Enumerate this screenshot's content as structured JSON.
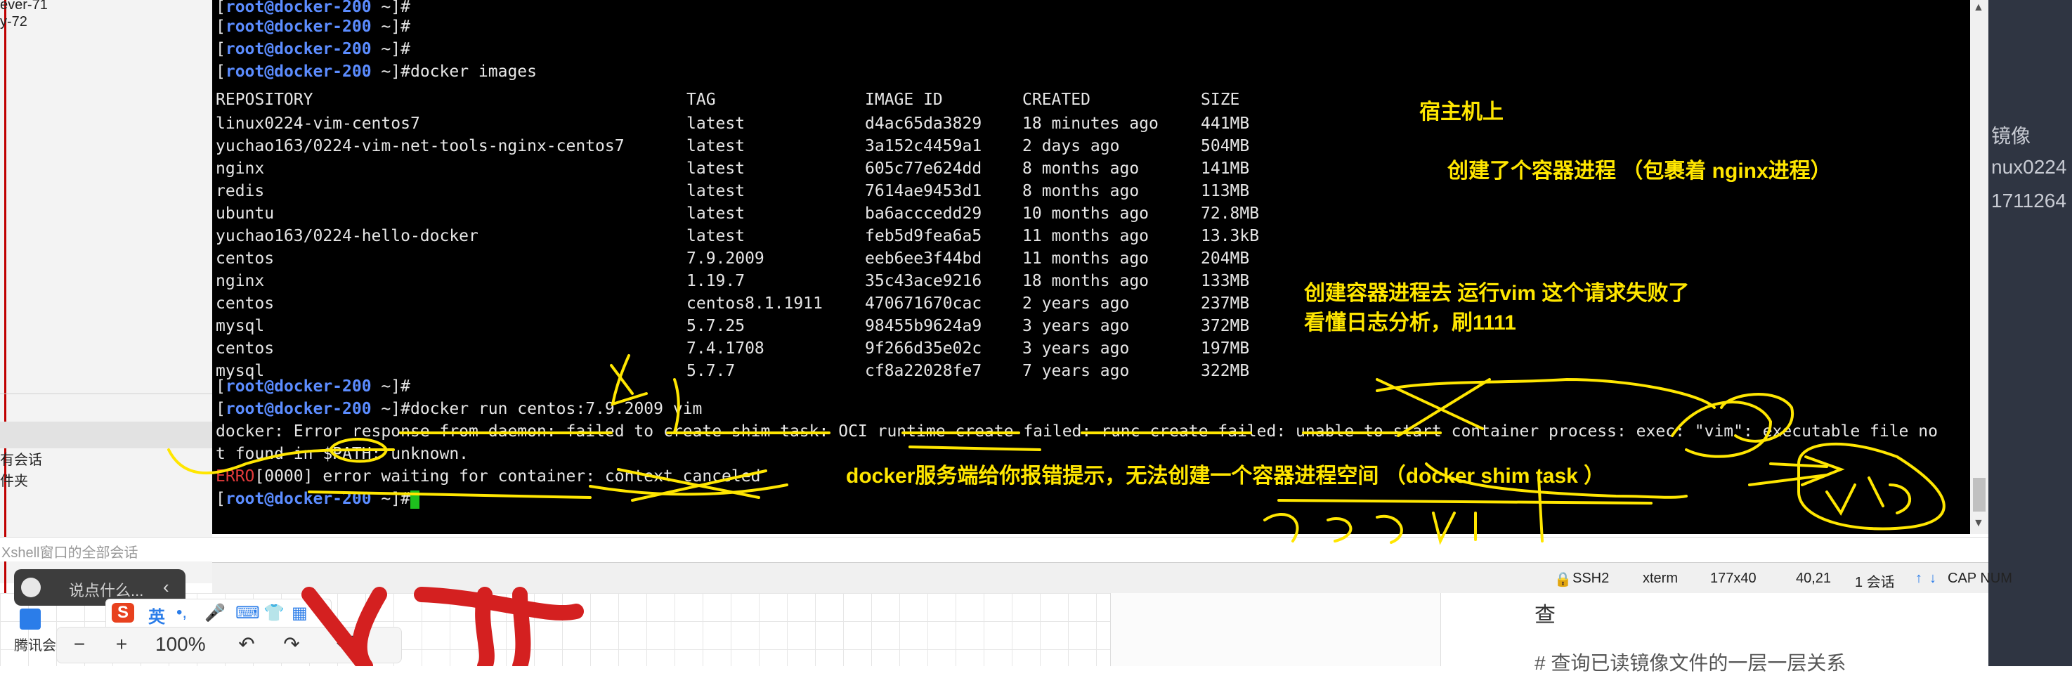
{
  "sidebar": {
    "items": [
      "ever-71",
      "y-72"
    ],
    "sessions": [
      "有会话",
      "件夹"
    ]
  },
  "terminal": {
    "prompt_user": "root@docker-200",
    "lines": [
      {
        "type": "prompt",
        "cmd": ""
      },
      {
        "type": "prompt",
        "cmd": ""
      },
      {
        "type": "prompt",
        "cmd": ""
      },
      {
        "type": "prompt",
        "cmd": "docker images"
      }
    ],
    "table": {
      "headers": [
        "REPOSITORY",
        "TAG",
        "IMAGE ID",
        "CREATED",
        "SIZE"
      ],
      "rows": [
        [
          "linux0224-vim-centos7",
          "latest",
          "d4ac65da3829",
          "18 minutes ago",
          "441MB"
        ],
        [
          "yuchao163/0224-vim-net-tools-nginx-centos7",
          "latest",
          "3a152c4459a1",
          "2 days ago",
          "504MB"
        ],
        [
          "nginx",
          "latest",
          "605c77e624dd",
          "8 months ago",
          "141MB"
        ],
        [
          "redis",
          "latest",
          "7614ae9453d1",
          "8 months ago",
          "113MB"
        ],
        [
          "ubuntu",
          "latest",
          "ba6acccedd29",
          "10 months ago",
          "72.8MB"
        ],
        [
          "yuchao163/0224-hello-docker",
          "latest",
          "feb5d9fea6a5",
          "11 months ago",
          "13.3kB"
        ],
        [
          "centos",
          "7.9.2009",
          "eeb6ee3f44bd",
          "11 months ago",
          "204MB"
        ],
        [
          "nginx",
          "1.19.7",
          "35c43ace9216",
          "18 months ago",
          "133MB"
        ],
        [
          "centos",
          "centos8.1.1911",
          "470671670cac",
          "2 years ago",
          "237MB"
        ],
        [
          "mysql",
          "5.7.25",
          "98455b9624a9",
          "3 years ago",
          "372MB"
        ],
        [
          "centos",
          "7.4.1708",
          "9f266d35e02c",
          "3 years ago",
          "197MB"
        ],
        [
          "mysql",
          "5.7.7",
          "cf8a22028fe7",
          "7 years ago",
          "322MB"
        ]
      ]
    },
    "after": [
      {
        "type": "prompt",
        "cmd": ""
      },
      {
        "type": "prompt",
        "cmd": "docker run centos:7.9.2009 vim"
      }
    ],
    "error_line1": "docker: Error response from daemon: failed to create shim task: OCI runtime create failed: runc create failed: unable to start container process: exec: \"vim\": executable file no",
    "error_line2": "t found in $PATH: unknown.",
    "errolabel": "ERRO",
    "erro_rest": "[0000] error waiting for container: context canceled"
  },
  "annotations": {
    "host": "宿主机上",
    "created": "创建了个容器进程  （包裹着 nginx进程）",
    "fail1": "创建容器进程去 运行vim 这个请求失败了",
    "fail2": "看懂日志分析，刷1111",
    "server": "docker服务端给你报错提示，无法创建一个容器进程空间  （docker shim task ）"
  },
  "hint": "Xshell窗口的全部会话",
  "statusbar": {
    "ssh": "SSH2",
    "term": "xterm",
    "size": "177x40",
    "pos": "40,21",
    "sessions": "1 会话",
    "caps": "CAP NUM"
  },
  "right_doc": [
    "镜像",
    "nux0224",
    "1711264"
  ],
  "right_text": {
    "heading": "查",
    "comment": "# 查询已读镜像文件的一层一层关系"
  },
  "say_bubble": "说点什么...",
  "ime": {
    "logo": "S",
    "lang": "英"
  },
  "zoom": {
    "level": "100%"
  },
  "tencent": "腾讯会",
  "colors": {
    "terminal_bg": "#000000",
    "prompt": "#5b8cff",
    "annotation": "#ffe600",
    "cursor": "#1ec01e",
    "ink_red": "#d42020"
  }
}
